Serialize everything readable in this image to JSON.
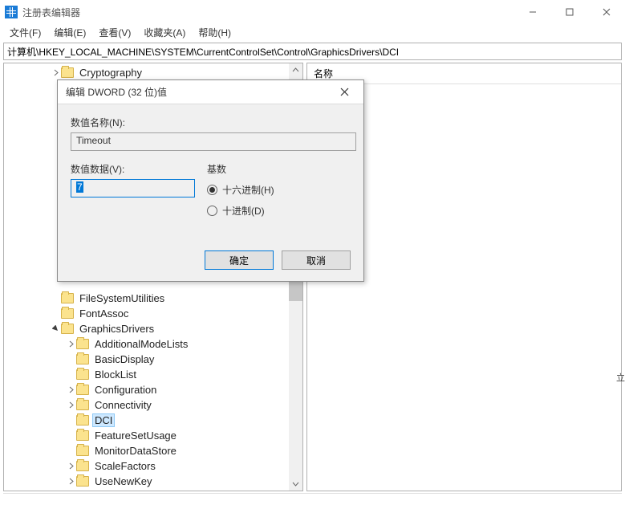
{
  "window": {
    "title": "注册表编辑器"
  },
  "menubar": {
    "file": "文件(F)",
    "edit": "编辑(E)",
    "view": "查看(V)",
    "favorites": "收藏夹(A)",
    "help": "帮助(H)"
  },
  "addressbar": {
    "path": "计算机\\HKEY_LOCAL_MACHINE\\SYSTEM\\CurrentControlSet\\Control\\GraphicsDrivers\\DCI"
  },
  "list": {
    "header_name": "名称"
  },
  "tree": {
    "items": [
      {
        "label": "Cryptography",
        "indent": 3,
        "exp": "closed",
        "selected": false
      },
      {
        "label": "FileSystemUtilities",
        "indent": 3,
        "exp": "none",
        "selected": false
      },
      {
        "label": "FontAssoc",
        "indent": 3,
        "exp": "none",
        "selected": false
      },
      {
        "label": "GraphicsDrivers",
        "indent": 3,
        "exp": "open",
        "selected": false
      },
      {
        "label": "AdditionalModeLists",
        "indent": 4,
        "exp": "closed",
        "selected": false
      },
      {
        "label": "BasicDisplay",
        "indent": 4,
        "exp": "none",
        "selected": false
      },
      {
        "label": "BlockList",
        "indent": 4,
        "exp": "none",
        "selected": false
      },
      {
        "label": "Configuration",
        "indent": 4,
        "exp": "closed",
        "selected": false
      },
      {
        "label": "Connectivity",
        "indent": 4,
        "exp": "closed",
        "selected": false
      },
      {
        "label": "DCI",
        "indent": 4,
        "exp": "none",
        "selected": true
      },
      {
        "label": "FeatureSetUsage",
        "indent": 4,
        "exp": "none",
        "selected": false
      },
      {
        "label": "MonitorDataStore",
        "indent": 4,
        "exp": "none",
        "selected": false
      },
      {
        "label": "ScaleFactors",
        "indent": 4,
        "exp": "closed",
        "selected": false
      },
      {
        "label": "UseNewKey",
        "indent": 4,
        "exp": "closed",
        "selected": false
      }
    ]
  },
  "dialog": {
    "title": "编辑 DWORD (32 位)值",
    "name_label": "数值名称(N):",
    "name_value": "Timeout",
    "data_label": "数值数据(V):",
    "data_value": "7",
    "base_label": "基数",
    "radio_hex": "十六进制(H)",
    "radio_dec": "十进制(D)",
    "base_selected": "hex",
    "ok": "确定",
    "cancel": "取消"
  },
  "side_hint": "立"
}
